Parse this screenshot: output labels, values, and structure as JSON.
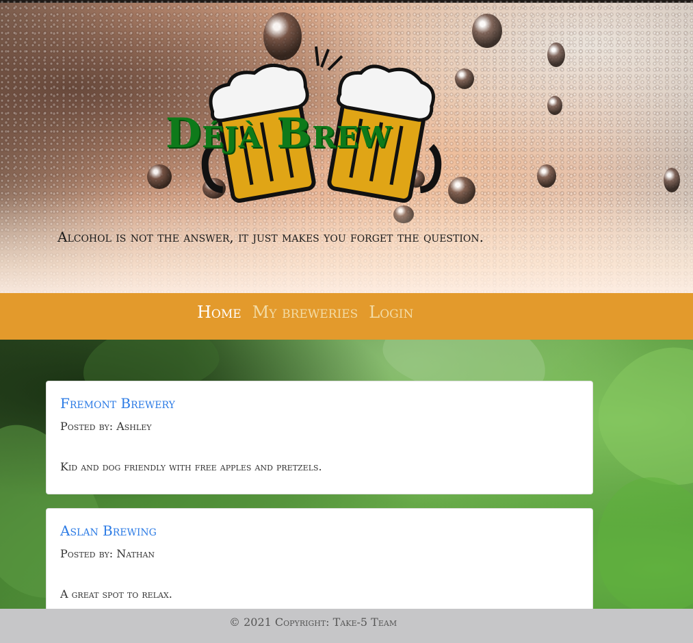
{
  "header": {
    "logo_text": "Déjà Brew",
    "tagline": "Alcohol is not the answer, it just makes you forget the question."
  },
  "nav": {
    "items": [
      {
        "label": "Home",
        "active": true
      },
      {
        "label": "My breweries",
        "active": false
      },
      {
        "label": "Login",
        "active": false
      }
    ]
  },
  "posts": [
    {
      "title": "Fremont Brewery",
      "author": "Posted by: Ashley",
      "body": "Kid and dog friendly with free apples and pretzels."
    },
    {
      "title": "Aslan Brewing",
      "author": "Posted by: Nathan",
      "body": "A great spot to relax."
    }
  ],
  "footer": {
    "text": "© 2021 Copyright: Take-5 Team"
  },
  "colors": {
    "nav_background": "#e39a2c",
    "logo_green": "#0e7a1a",
    "beer_gold": "#e0a516",
    "link_blue": "#2c7be5",
    "footer_background": "#c6c6c8"
  }
}
